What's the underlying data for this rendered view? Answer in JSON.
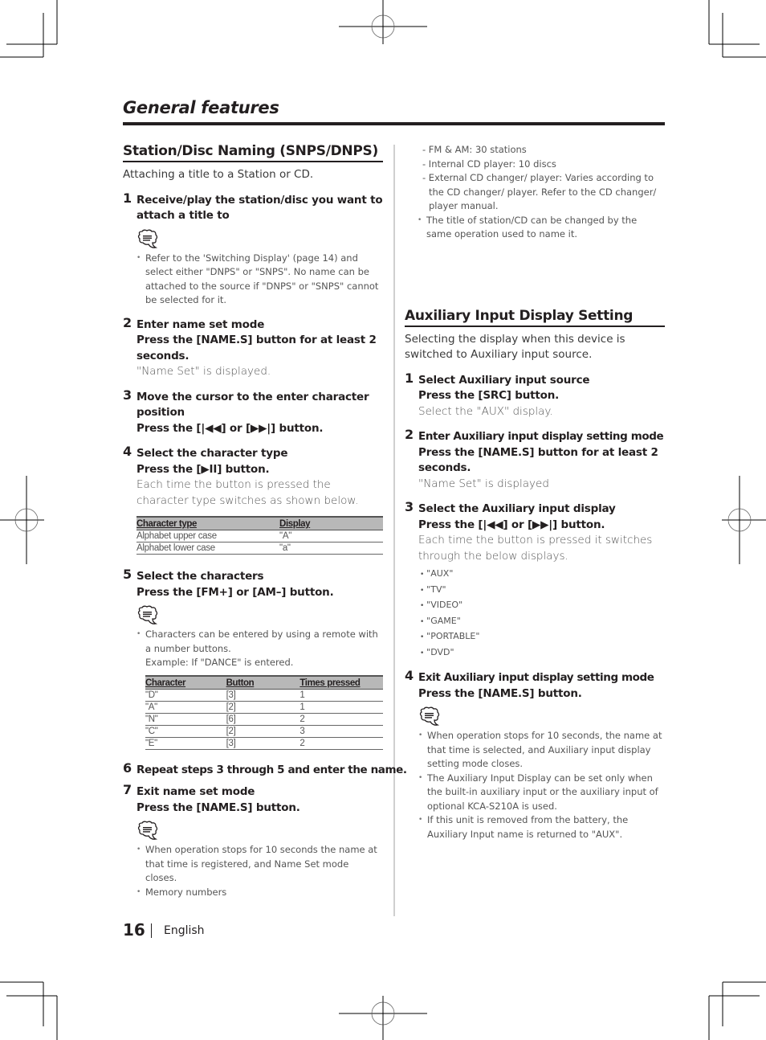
{
  "page": {
    "title": "General features",
    "page_number": "16",
    "language": "English"
  },
  "left": {
    "heading": "Station/Disc Naming (SNPS/DNPS)",
    "intro": "Attaching a title to a Station or CD.",
    "steps": [
      {
        "num": "1",
        "title": "Receive/play the station/disc you want to attach a title to",
        "notes": [
          "Refer to the 'Switching Display' (page 14) and select either \"DNPS\" or \"SNPS\". No name can be attached to the source if \"DNPS\" or \"SNPS\" cannot be selected for it."
        ]
      },
      {
        "num": "2",
        "title": "Enter name set mode",
        "action": "Press the [NAME.S] button for at least 2 seconds.",
        "desc": "\"Name Set\" is displayed."
      },
      {
        "num": "3",
        "title": "Move the cursor to the enter character position",
        "action": "Press the [|◀◀] or [▶▶|] button."
      },
      {
        "num": "4",
        "title": "Select the character type",
        "action": "Press the [▶II] button.",
        "desc": "Each time the button is pressed the character type switches as shown below."
      },
      {
        "num": "5",
        "title": "Select the characters",
        "action": "Press the [FM+] or [AM–] button.",
        "notes": [
          "Characters can be entered by using a remote with a number buttons."
        ],
        "example": "Example: If \"DANCE\" is entered."
      },
      {
        "num": "6",
        "title": "Repeat steps 3 through 5 and enter the name."
      },
      {
        "num": "7",
        "title": "Exit name set mode",
        "action": "Press the [NAME.S] button.",
        "notes": [
          "When operation stops for 10 seconds the name at that time is registered, and Name Set mode closes.",
          "Memory numbers"
        ]
      }
    ],
    "char_type_table": {
      "headers": [
        "Character type",
        "Display"
      ],
      "rows": [
        [
          "Alphabet upper case",
          "\"A\""
        ],
        [
          "Alphabet lower case",
          "\"a\""
        ]
      ]
    },
    "dance_table": {
      "headers": [
        "Character",
        "Button",
        "Times pressed"
      ],
      "rows": [
        [
          "\"D\"",
          "[3]",
          "1"
        ],
        [
          "\"A\"",
          "[2]",
          "1"
        ],
        [
          "\"N\"",
          "[6]",
          "2"
        ],
        [
          "\"C\"",
          "[2]",
          "3"
        ],
        [
          "\"E\"",
          "[3]",
          "2"
        ]
      ]
    }
  },
  "right": {
    "memory_list": [
      "- FM & AM: 30 stations",
      "- Internal CD player: 10 discs",
      "- External CD changer/ player: Varies according to the CD changer/ player. Refer to the CD changer/ player manual."
    ],
    "memory_note": "The title of station/CD can be changed by the same operation used to name it.",
    "heading": "Auxiliary Input Display Setting",
    "intro": "Selecting the display when this device is switched to Auxiliary input source.",
    "steps": [
      {
        "num": "1",
        "title": "Select Auxiliary input source",
        "action": "Press the [SRC] button.",
        "desc": "Select the \"AUX\" display."
      },
      {
        "num": "2",
        "title": "Enter Auxiliary input display setting mode",
        "action": "Press the [NAME.S] button for at least 2 seconds.",
        "desc": "\"Name Set\" is displayed"
      },
      {
        "num": "3",
        "title": "Select the Auxiliary input display",
        "action": "Press the [|◀◀] or [▶▶|] button.",
        "desc": "Each time the button is pressed it switches through the below displays."
      },
      {
        "num": "4",
        "title": "Exit Auxiliary input display setting mode",
        "action": "Press the [NAME.S] button.",
        "notes": [
          "When operation stops for 10 seconds, the name at that time is selected, and Auxiliary input display setting mode closes.",
          "The Auxiliary Input Display can be set only when the built-in auxiliary input or the auxiliary input of optional KCA-S210A is used.",
          "If this unit is removed from the battery, the Auxiliary Input name is returned to \"AUX\"."
        ]
      }
    ],
    "displays": [
      "\"AUX\"",
      "\"TV\"",
      "\"VIDEO\"",
      "\"GAME\"",
      "\"PORTABLE\"",
      "\"DVD\""
    ]
  }
}
